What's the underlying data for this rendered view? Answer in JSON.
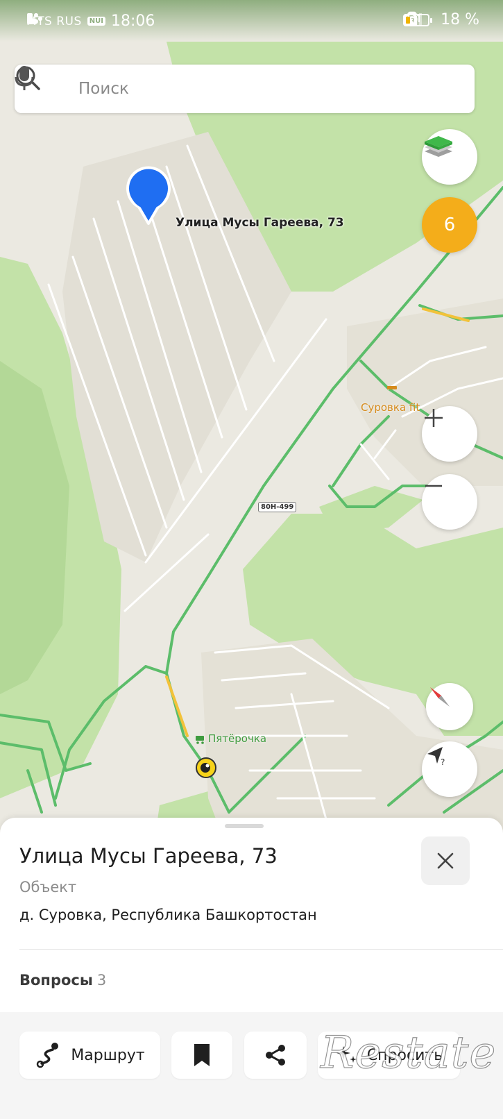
{
  "status_bar": {
    "carrier": "MTS RUS",
    "network_tag": "NUI",
    "time": "18:06",
    "battery": "18 %"
  },
  "search": {
    "placeholder": "Поиск"
  },
  "map": {
    "clusters_badge": "6",
    "pin_label": "Улица Мусы Гареева, 73",
    "poi_surovka_fit": "Суровка fit",
    "poi_pyaterochka": "Пятёрочка",
    "road_sign": "80Н-499",
    "colors": {
      "forest": "#bfe0a5",
      "roads": "#5cbd6a",
      "pin": "#1f6ef2",
      "badge": "#f4ad1a"
    }
  },
  "place": {
    "title": "Улица Мусы Гареева, 73",
    "type": "Объект",
    "address": "д. Суровка, Республика Башкортостан",
    "questions_label": "Вопросы",
    "questions_count": "3"
  },
  "actions": {
    "route": "Маршрут",
    "ask": "Спросить"
  },
  "watermark": "Restate"
}
